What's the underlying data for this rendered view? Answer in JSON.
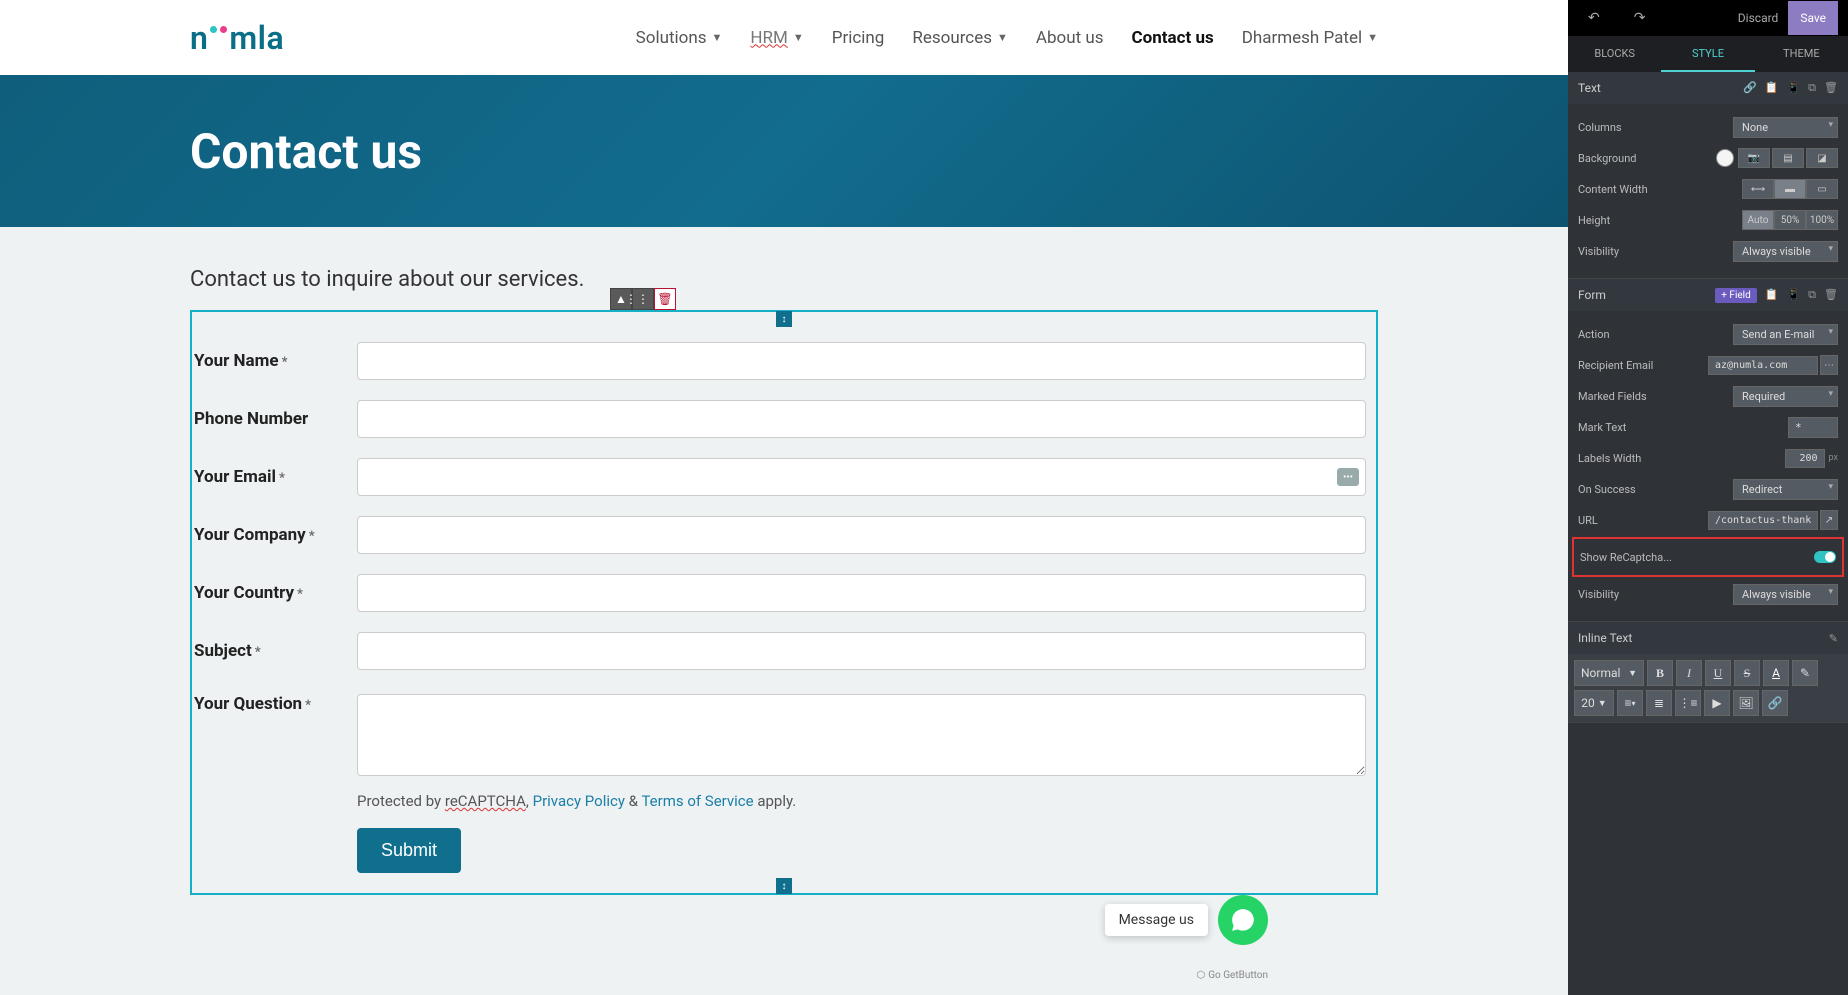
{
  "header": {
    "logo_text_1": "n",
    "logo_text_2": "mla",
    "nav": {
      "solutions": "Solutions",
      "hrm": "HRM",
      "pricing": "Pricing",
      "resources": "Resources",
      "about": "About us",
      "contact": "Contact us",
      "user": "Dharmesh Patel"
    }
  },
  "hero": {
    "title": "Contact us"
  },
  "intro": "Contact us to inquire about our services.",
  "form": {
    "name_label": "Your Name",
    "phone_label": "Phone Number",
    "email_label": "Your Email",
    "company_label": "Your Company",
    "country_label": "Your Country",
    "subject_label": "Subject",
    "question_label": "Your Question",
    "asterisk": "*",
    "protected_prefix": "Protected by ",
    "recaptcha": "reCAPTCHA",
    "comma": ", ",
    "privacy": "Privacy Policy",
    "amp": " & ",
    "tos": "Terms of Service",
    "apply": " apply.",
    "submit": "Submit"
  },
  "panel": {
    "top": {
      "discard": "Discard",
      "save": "Save"
    },
    "tabs": {
      "blocks": "BLOCKS",
      "style": "STYLE",
      "theme": "THEME"
    },
    "text_sec": {
      "title": "Text",
      "columns": "Columns",
      "columns_val": "None",
      "background": "Background",
      "content_width": "Content Width",
      "height": "Height",
      "h_auto": "Auto",
      "h_50": "50%",
      "h_100": "100%",
      "visibility": "Visibility",
      "vis_val": "Always visible"
    },
    "form_sec": {
      "title": "Form",
      "add_field": "+ Field",
      "action": "Action",
      "action_val": "Send an E-mail",
      "recipient": "Recipient Email",
      "recipient_val": "az@numla.com",
      "marked": "Marked Fields",
      "marked_val": "Required",
      "mark_text": "Mark Text",
      "mark_val": "*",
      "labels_width": "Labels Width",
      "labels_val": "200",
      "px": "px",
      "on_success": "On Success",
      "on_success_val": "Redirect",
      "url": "URL",
      "url_val": "/contactus-thank",
      "show_recaptcha": "Show ReCaptcha...",
      "visibility": "Visibility",
      "vis_val": "Always visible"
    },
    "inline": {
      "title": "Inline Text",
      "normal": "Normal",
      "size": "20"
    }
  },
  "chat": {
    "msg": "Message us",
    "getbutton": "Go GetButton"
  }
}
